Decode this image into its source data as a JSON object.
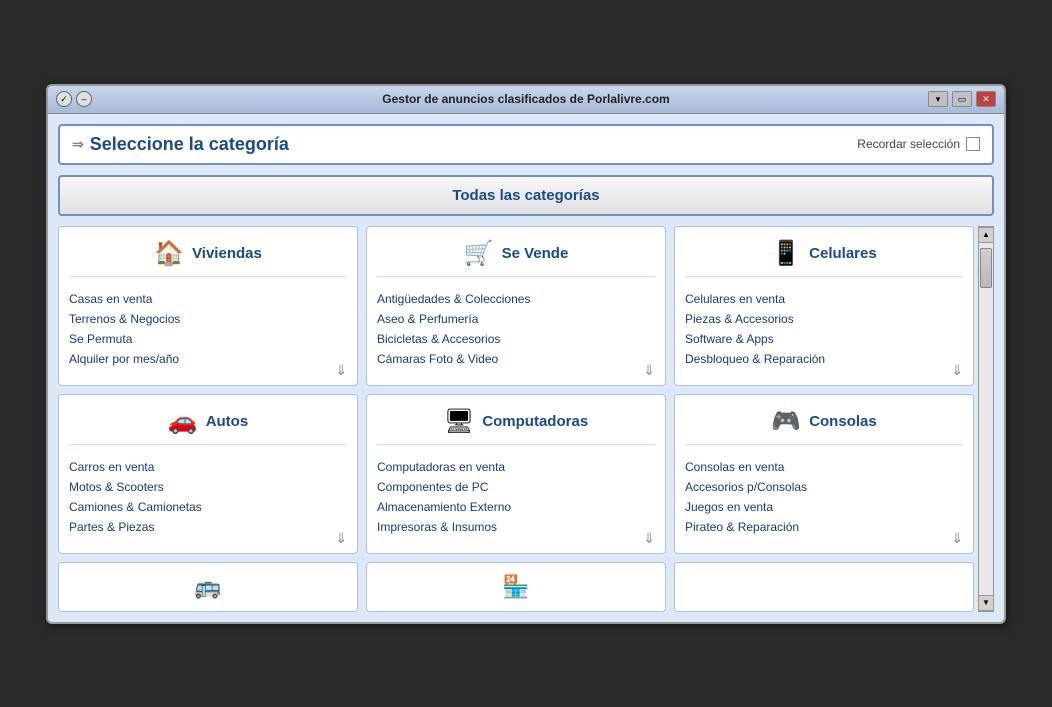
{
  "window": {
    "title": "Gestor de anuncios clasificados de Porlalivre.com",
    "titlebar_btns": [
      "●",
      "–"
    ],
    "ctrl_btns": [
      "▾",
      "▭",
      "✕"
    ]
  },
  "header": {
    "arrow": "⇒",
    "title": "Seleccione la categoría",
    "remember_label": "Recordar selección"
  },
  "all_categories_btn": "Todas las categorías",
  "categories": [
    {
      "icon": "🏠",
      "name": "Viviendas",
      "items": [
        "Casas en venta",
        "Terrenos & Negocios",
        "Se Permuta",
        "Alquiler por mes/año"
      ]
    },
    {
      "icon": "🛒",
      "name": "Se Vende",
      "items": [
        "Antigüedades & Colecciones",
        "Aseo & Perfumería",
        "Bicicletas & Accesorios",
        "Cámaras Foto & Video"
      ]
    },
    {
      "icon": "📱",
      "name": "Celulares",
      "items": [
        "Celulares en venta",
        "Piezas & Accesorios",
        "Software & Apps",
        "Desbloqueo & Reparación"
      ]
    },
    {
      "icon": "🚗",
      "name": "Autos",
      "items": [
        "Carros en venta",
        "Motos & Scooters",
        "Camiones & Camionetas",
        "Partes & Piezas"
      ]
    },
    {
      "icon": "🖥",
      "name": "Computadoras",
      "items": [
        "Computadoras en venta",
        "Componentes de PC",
        "Almacenamiento Externo",
        "Impresoras & Insumos"
      ]
    },
    {
      "icon": "🎮",
      "name": "Consolas",
      "items": [
        "Consolas en venta",
        "Accesorios p/Consolas",
        "Juegos en venta",
        "Pirateo & Reparación"
      ]
    }
  ],
  "partial_icons": [
    "🚌",
    "🏪",
    ""
  ]
}
